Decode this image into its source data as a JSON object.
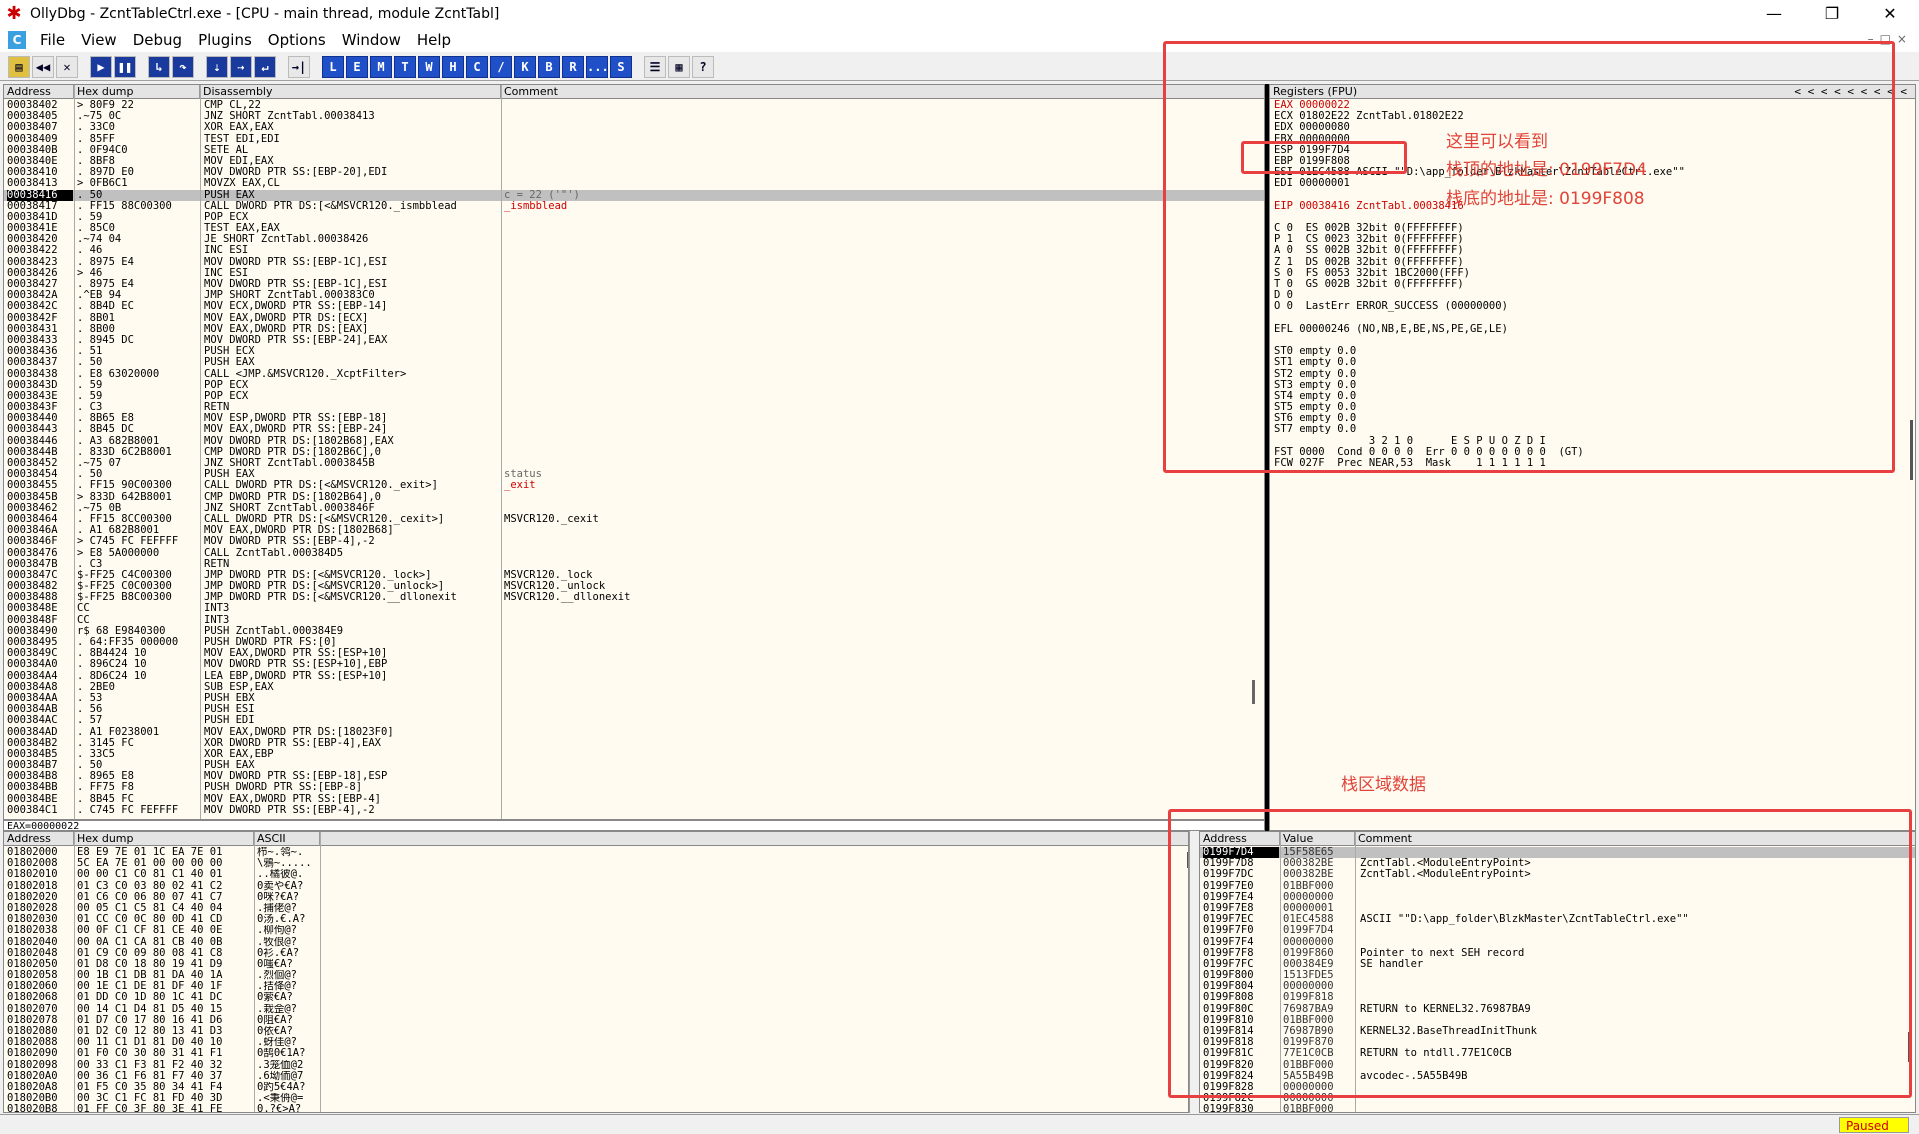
{
  "window": {
    "title": "OllyDbg - ZcntTableCtrl.exe - [CPU - main thread, module ZcntTabl]",
    "min": "—",
    "max": "❐",
    "close": "✕"
  },
  "menu": {
    "icon": "C",
    "items": [
      "File",
      "View",
      "Debug",
      "Plugins",
      "Options",
      "Window",
      "Help"
    ],
    "mdi_buttons": "–□×"
  },
  "toolbar": {
    "buttons": [
      "open",
      "rewind",
      "close",
      "run",
      "pause",
      "step-into",
      "step-over",
      "trace-into",
      "trace-over",
      "execute-till-return",
      "go-to"
    ],
    "letters": [
      "L",
      "E",
      "M",
      "T",
      "W",
      "H",
      "C",
      "/",
      "K",
      "B",
      "R",
      "...",
      "S"
    ],
    "extra": [
      "list",
      "grid",
      "?"
    ]
  },
  "disasm": {
    "headers": [
      "Address",
      "Hex dump",
      "Disassembly",
      "Comment"
    ],
    "rows": [
      [
        "00038402",
        "> 80F9 22",
        "CMP CL,22",
        ""
      ],
      [
        "00038405",
        ".~75 0C",
        "JNZ SHORT ZcntTabl.00038413",
        ""
      ],
      [
        "00038407",
        ". 33C0",
        "XOR EAX,EAX",
        ""
      ],
      [
        "00038409",
        ". 85FF",
        "TEST EDI,EDI",
        ""
      ],
      [
        "0003840B",
        ". 0F94C0",
        "SETE AL",
        ""
      ],
      [
        "0003840E",
        ". 8BF8",
        "MOV EDI,EAX",
        ""
      ],
      [
        "00038410",
        ". 897D E0",
        "MOV DWORD PTR SS:[EBP-20],EDI",
        ""
      ],
      [
        "00038413",
        "> 0FB6C1",
        "MOVZX EAX,CL",
        ""
      ],
      [
        "00038416",
        ". 50",
        "PUSH EAX",
        "c = 22  ('\"')"
      ],
      [
        "00038417",
        ". FF15 88C00300",
        "CALL DWORD PTR DS:[<&MSVCR120._ismbblead",
        "_ismbblead"
      ],
      [
        "0003841D",
        ". 59",
        "POP ECX",
        ""
      ],
      [
        "0003841E",
        ". 85C0",
        "TEST EAX,EAX",
        ""
      ],
      [
        "00038420",
        ".~74 04",
        "JE SHORT ZcntTabl.00038426",
        ""
      ],
      [
        "00038422",
        ". 46",
        "INC ESI",
        ""
      ],
      [
        "00038423",
        ". 8975 E4",
        "MOV DWORD PTR SS:[EBP-1C],ESI",
        ""
      ],
      [
        "00038426",
        "> 46",
        "INC ESI",
        ""
      ],
      [
        "00038427",
        ". 8975 E4",
        "MOV DWORD PTR SS:[EBP-1C],ESI",
        ""
      ],
      [
        "0003842A",
        ".^EB 94",
        "JMP SHORT ZcntTabl.000383C0",
        ""
      ],
      [
        "0003842C",
        ". 8B4D EC",
        "MOV ECX,DWORD PTR SS:[EBP-14]",
        ""
      ],
      [
        "0003842F",
        ". 8B01",
        "MOV EAX,DWORD PTR DS:[ECX]",
        ""
      ],
      [
        "00038431",
        ". 8B00",
        "MOV EAX,DWORD PTR DS:[EAX]",
        ""
      ],
      [
        "00038433",
        ". 8945 DC",
        "MOV DWORD PTR SS:[EBP-24],EAX",
        ""
      ],
      [
        "00038436",
        ". 51",
        "PUSH ECX",
        ""
      ],
      [
        "00038437",
        ". 50",
        "PUSH EAX",
        ""
      ],
      [
        "00038438",
        ". E8 63020000",
        "CALL <JMP.&MSVCR120._XcptFilter>",
        ""
      ],
      [
        "0003843D",
        ". 59",
        "POP ECX",
        ""
      ],
      [
        "0003843E",
        ". 59",
        "POP ECX",
        ""
      ],
      [
        "0003843F",
        ". C3",
        "RETN",
        ""
      ],
      [
        "00038440",
        ". 8B65 E8",
        "MOV ESP,DWORD PTR SS:[EBP-18]",
        ""
      ],
      [
        "00038443",
        ". 8B45 DC",
        "MOV EAX,DWORD PTR SS:[EBP-24]",
        ""
      ],
      [
        "00038446",
        ". A3 682B8001",
        "MOV DWORD PTR DS:[1802B68],EAX",
        ""
      ],
      [
        "0003844B",
        ". 833D 6C2B8001",
        "CMP DWORD PTR DS:[1802B6C],0",
        ""
      ],
      [
        "00038452",
        ".~75 07",
        "JNZ SHORT ZcntTabl.0003845B",
        ""
      ],
      [
        "00038454",
        ". 50",
        "PUSH EAX",
        "status"
      ],
      [
        "00038455",
        ". FF15 90C00300",
        "CALL DWORD PTR DS:[<&MSVCR120._exit>]",
        "_exit"
      ],
      [
        "0003845B",
        "> 833D 642B8001",
        "CMP DWORD PTR DS:[1802B64],0",
        ""
      ],
      [
        "00038462",
        ".~75 0B",
        "JNZ SHORT ZcntTabl.0003846F",
        ""
      ],
      [
        "00038464",
        ". FF15 8CC00300",
        "CALL DWORD PTR DS:[<&MSVCR120._cexit>]",
        "MSVCR120._cexit"
      ],
      [
        "0003846A",
        ". A1 682B8001",
        "MOV EAX,DWORD PTR DS:[1802B68]",
        ""
      ],
      [
        "0003846F",
        "> C745 FC FEFFFF",
        "MOV DWORD PTR SS:[EBP-4],-2",
        ""
      ],
      [
        "00038476",
        "> E8 5A000000",
        "CALL ZcntTabl.000384D5",
        ""
      ],
      [
        "0003847B",
        ". C3",
        "RETN",
        ""
      ],
      [
        "0003847C",
        "$-FF25 C4C00300",
        "JMP DWORD PTR DS:[<&MSVCR120._lock>]",
        "MSVCR120._lock"
      ],
      [
        "00038482",
        "$-FF25 C0C00300",
        "JMP DWORD PTR DS:[<&MSVCR120._unlock>]",
        "MSVCR120._unlock"
      ],
      [
        "00038488",
        "$-FF25 B8C00300",
        "JMP DWORD PTR DS:[<&MSVCR120.__dllonexit",
        "MSVCR120.__dllonexit"
      ],
      [
        "0003848E",
        "  CC",
        "INT3",
        ""
      ],
      [
        "0003848F",
        "  CC",
        "INT3",
        ""
      ],
      [
        "00038490",
        "r$ 68 E9840300",
        "PUSH ZcntTabl.000384E9",
        ""
      ],
      [
        "00038495",
        ". 64:FF35 000000",
        "PUSH DWORD PTR FS:[0]",
        ""
      ],
      [
        "0003849C",
        ". 8B4424 10",
        "MOV EAX,DWORD PTR SS:[ESP+10]",
        ""
      ],
      [
        "000384A0",
        ". 896C24 10",
        "MOV DWORD PTR SS:[ESP+10],EBP",
        ""
      ],
      [
        "000384A4",
        ". 8D6C24 10",
        "LEA EBP,DWORD PTR SS:[ESP+10]",
        ""
      ],
      [
        "000384A8",
        ". 2BE0",
        "SUB ESP,EAX",
        ""
      ],
      [
        "000384AA",
        ". 53",
        "PUSH EBX",
        ""
      ],
      [
        "000384AB",
        ". 56",
        "PUSH ESI",
        ""
      ],
      [
        "000384AC",
        ". 57",
        "PUSH EDI",
        ""
      ],
      [
        "000384AD",
        ". A1 F0238001",
        "MOV EAX,DWORD PTR DS:[18023F0]",
        ""
      ],
      [
        "000384B2",
        ". 3145 FC",
        "XOR DWORD PTR SS:[EBP-4],EAX",
        ""
      ],
      [
        "000384B5",
        ". 33C5",
        "XOR EAX,EBP",
        ""
      ],
      [
        "000384B7",
        ". 50",
        "PUSH EAX",
        ""
      ],
      [
        "000384B8",
        ". 8965 E8",
        "MOV DWORD PTR SS:[EBP-18],ESP",
        ""
      ],
      [
        "000384BB",
        ". FF75 F8",
        "PUSH DWORD PTR SS:[EBP-8]",
        ""
      ],
      [
        "000384BE",
        ". 8B45 FC",
        "MOV EAX,DWORD PTR SS:[EBP-4]",
        ""
      ],
      [
        "000384C1",
        ". C745 FC FEFFFF",
        "MOV DWORD PTR SS:[EBP-4],-2",
        ""
      ]
    ],
    "info_line": "EAX=00000022"
  },
  "registers": {
    "header": "Registers (FPU)",
    "nav": "<   <   <   <   <   <   <   <   <",
    "lines": [
      "EAX 00000022",
      "ECX 01802E22 ZcntTabl.01802E22",
      "EDX 00000080",
      "EBX 00000000",
      "ESP 0199F7D4",
      "EBP 0199F808",
      "ESI 01EC4588 ASCII \"\"D:\\app_folder\\BlzkMaster\\ZcntTableCtrl.exe\"\"",
      "EDI 00000001",
      "",
      "EIP 00038416 ZcntTabl.00038416",
      "",
      "C 0  ES 002B 32bit 0(FFFFFFFF)",
      "P 1  CS 0023 32bit 0(FFFFFFFF)",
      "A 0  SS 002B 32bit 0(FFFFFFFF)",
      "Z 1  DS 002B 32bit 0(FFFFFFFF)",
      "S 0  FS 0053 32bit 1BC2000(FFF)",
      "T 0  GS 002B 32bit 0(FFFFFFFF)",
      "D 0",
      "O 0  LastErr ERROR_SUCCESS (00000000)",
      "",
      "EFL 00000246 (NO,NB,E,BE,NS,PE,GE,LE)",
      "",
      "ST0 empty 0.0",
      "ST1 empty 0.0",
      "ST2 empty 0.0",
      "ST3 empty 0.0",
      "ST4 empty 0.0",
      "ST5 empty 0.0",
      "ST6 empty 0.0",
      "ST7 empty 0.0",
      "               3 2 1 0      E S P U O Z D I",
      "FST 0000  Cond 0 0 0 0  Err 0 0 0 0 0 0 0 0  (GT)",
      "FCW 027F  Prec NEAR,53  Mask    1 1 1 1 1 1"
    ]
  },
  "dump": {
    "headers": [
      "Address",
      "Hex dump",
      "ASCII"
    ],
    "rows": [
      [
        "01802000",
        "E8 E9 7E 01 1C EA 7E 01",
        "栉~.鸰~."
      ],
      [
        "01802008",
        "5C EA 7E 01 00 00 00 00",
        "\\鴉~....."
      ],
      [
        "01802010",
        "00 00 C1 C0 81 C1 40 01",
        "..橘彼@."
      ],
      [
        "01802018",
        "01 C3 C0 03 80 02 41 C2",
        "0卖や€A?"
      ],
      [
        "01802020",
        "01 C6 C0 06 80 07 41 C7",
        "0咪?€A?"
      ],
      [
        "01802028",
        "00 05 C1 C5 81 C4 40 04",
        ".捕佬@?"
      ],
      [
        "01802030",
        "01 CC C0 0C 80 0D 41 CD",
        "0汤.€.A?"
      ],
      [
        "01802038",
        "00 0F C1 CF 81 CE 40 0E",
        ".柳佝@?"
      ],
      [
        "01802040",
        "00 0A C1 CA 81 CB 40 0B",
        ".牧佷@?"
      ],
      [
        "01802048",
        "01 C9 C0 09 80 08 41 C8",
        "0衫.€A?"
      ],
      [
        "01802050",
        "01 D8 C0 18 80 19 41 D9",
        "0嗤€A?"
      ],
      [
        "01802058",
        "00 1B C1 DB 81 DA 40 1A",
        ".烈佪@?"
      ],
      [
        "01802060",
        "00 1E C1 DE 81 DF 40 1F",
        ".拮佭@?"
      ],
      [
        "01802068",
        "01 DD C0 1D 80 1C 41 DC",
        "0萦€A?"
      ],
      [
        "01802070",
        "00 14 C1 D4 81 D5 40 15",
        ".栽佱@?"
      ],
      [
        "01802078",
        "01 D7 C0 17 80 16 41 D6",
        "0阻€A?"
      ],
      [
        "01802080",
        "01 D2 C0 12 80 13 41 D3",
        "0依€A?"
      ],
      [
        "01802088",
        "00 11 C1 D1 81 D0 40 10",
        ".蚜佳@?"
      ],
      [
        "01802090",
        "01 F0 C0 30 80 31 41 F1",
        "0鹄0€1A?"
      ],
      [
        "01802098",
        "00 33 C1 F3 81 F2 40 32",
        ".3笼侐@2"
      ],
      [
        "018020A0",
        "00 36 C1 F6 81 F7 40 37",
        ".6坳侕@7"
      ],
      [
        "018020A8",
        "01 F5 C0 35 80 34 41 F4",
        "0趵5€4A?"
      ],
      [
        "018020B0",
        "00 3C C1 FC 81 FD 40 3D",
        ".<秉侜@="
      ],
      [
        "018020B8",
        "01 FF C0 3F 80 3E 41 FE",
        "0.?€>A?"
      ]
    ]
  },
  "stack": {
    "headers": [
      "Address",
      "Value",
      "Comment"
    ],
    "rows": [
      [
        "0199F7D4",
        "15F58E65",
        ""
      ],
      [
        "0199F7D8",
        "000382BE",
        "ZcntTabl.<ModuleEntryPoint>"
      ],
      [
        "0199F7DC",
        "000382BE",
        "ZcntTabl.<ModuleEntryPoint>"
      ],
      [
        "0199F7E0",
        "01BBF000",
        ""
      ],
      [
        "0199F7E4",
        "00000000",
        ""
      ],
      [
        "0199F7E8",
        "00000001",
        ""
      ],
      [
        "0199F7EC",
        "01EC4588",
        "ASCII \"\"D:\\app_folder\\BlzkMaster\\ZcntTableCtrl.exe\"\""
      ],
      [
        "0199F7F0",
        "0199F7D4",
        ""
      ],
      [
        "0199F7F4",
        "00000000",
        ""
      ],
      [
        "0199F7F8",
        "0199F860",
        "Pointer to next SEH record"
      ],
      [
        "0199F7FC",
        "000384E9",
        "SE handler"
      ],
      [
        "0199F800",
        "1513FDE5",
        ""
      ],
      [
        "0199F804",
        "00000000",
        ""
      ],
      [
        "0199F808",
        "0199F818",
        ""
      ],
      [
        "0199F80C",
        "76987BA9",
        "RETURN to KERNEL32.76987BA9"
      ],
      [
        "0199F810",
        "01BBF000",
        ""
      ],
      [
        "0199F814",
        "76987B90",
        "KERNEL32.BaseThreadInitThunk"
      ],
      [
        "0199F818",
        "0199F870",
        ""
      ],
      [
        "0199F81C",
        "77E1C0CB",
        "RETURN to ntdll.77E1C0CB"
      ],
      [
        "0199F820",
        "01BBF000",
        ""
      ],
      [
        "0199F824",
        "5A55B49B",
        "avcodec-.5A55B49B"
      ],
      [
        "0199F828",
        "00000000",
        ""
      ],
      [
        "0199F82C",
        "00000000",
        ""
      ],
      [
        "0199F830",
        "01BBF000",
        ""
      ]
    ]
  },
  "annotations": {
    "a1": "这里可以看到",
    "a2": "栈顶的地址是:   0199F7D4",
    "a3": "栈底的地址是:   0199F808",
    "a4": "栈区域数据"
  },
  "status": {
    "state": "Paused"
  }
}
